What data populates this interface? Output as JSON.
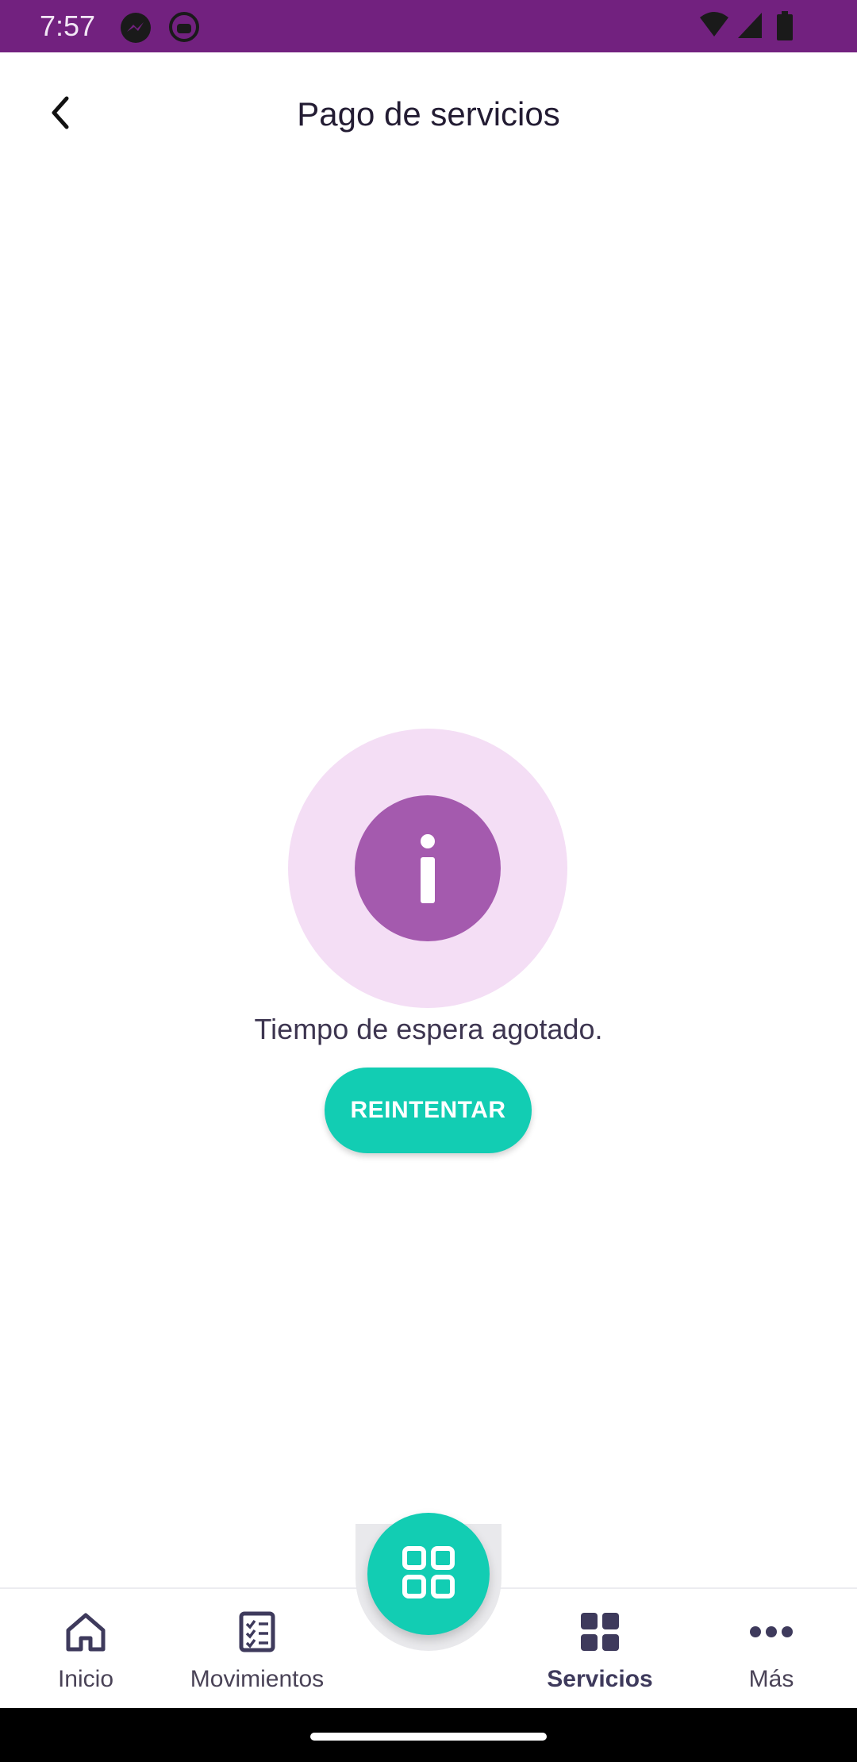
{
  "status_bar": {
    "time": "7:57",
    "icons": [
      "messenger-icon",
      "android-robot-icon",
      "wifi-icon",
      "cell-signal-icon",
      "battery-icon"
    ]
  },
  "app_bar": {
    "title": "Pago de servicios",
    "back_icon": "chevron-left-icon"
  },
  "main": {
    "info_icon": "info-icon",
    "message": "Tiempo de espera agotado.",
    "retry_label": "REINTENTAR"
  },
  "bottom_nav": {
    "items": [
      {
        "label": "Inicio",
        "icon": "home-icon"
      },
      {
        "label": "Movimientos",
        "icon": "checklist-icon"
      },
      {
        "label": "Servicios",
        "icon": "grid-icon",
        "active": true
      },
      {
        "label": "Más",
        "icon": "more-horiz-icon"
      }
    ],
    "fab_icon": "qr-grid-icon"
  },
  "colors": {
    "status_bar": "#72217f",
    "accent": "#12cdb3",
    "info_halo": "#f4def5",
    "info_disc": "#a45aae",
    "title_text": "#231c33"
  }
}
